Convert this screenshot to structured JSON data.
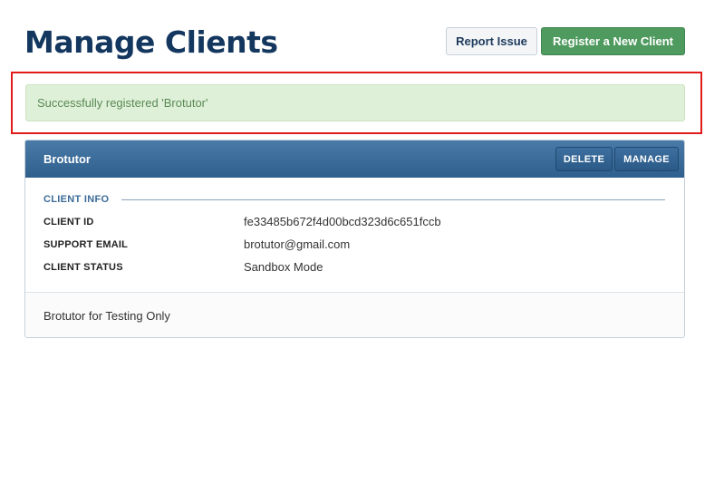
{
  "header": {
    "title": "Manage Clients",
    "report_issue_label": "Report Issue",
    "register_label": "Register a New Client"
  },
  "alert": {
    "message": "Successfully registered 'Brotutor'",
    "status_color": "#dff0d8"
  },
  "client": {
    "name": "Brotutor",
    "delete_label": "DELETE",
    "manage_label": "MANAGE",
    "section_label": "CLIENT INFO",
    "rows": [
      {
        "key": "CLIENT ID",
        "value": "fe33485b672f4d00bcd323d6c651fccb"
      },
      {
        "key": "SUPPORT EMAIL",
        "value": "brotutor@gmail.com"
      },
      {
        "key": "CLIENT STATUS",
        "value": "Sandbox Mode"
      }
    ],
    "description": "Brotutor for Testing Only"
  },
  "colors": {
    "title": "#14375f",
    "accent_green": "#4f9a5f",
    "card_header": "#2f5f8c",
    "highlight": "#e01b1b"
  }
}
